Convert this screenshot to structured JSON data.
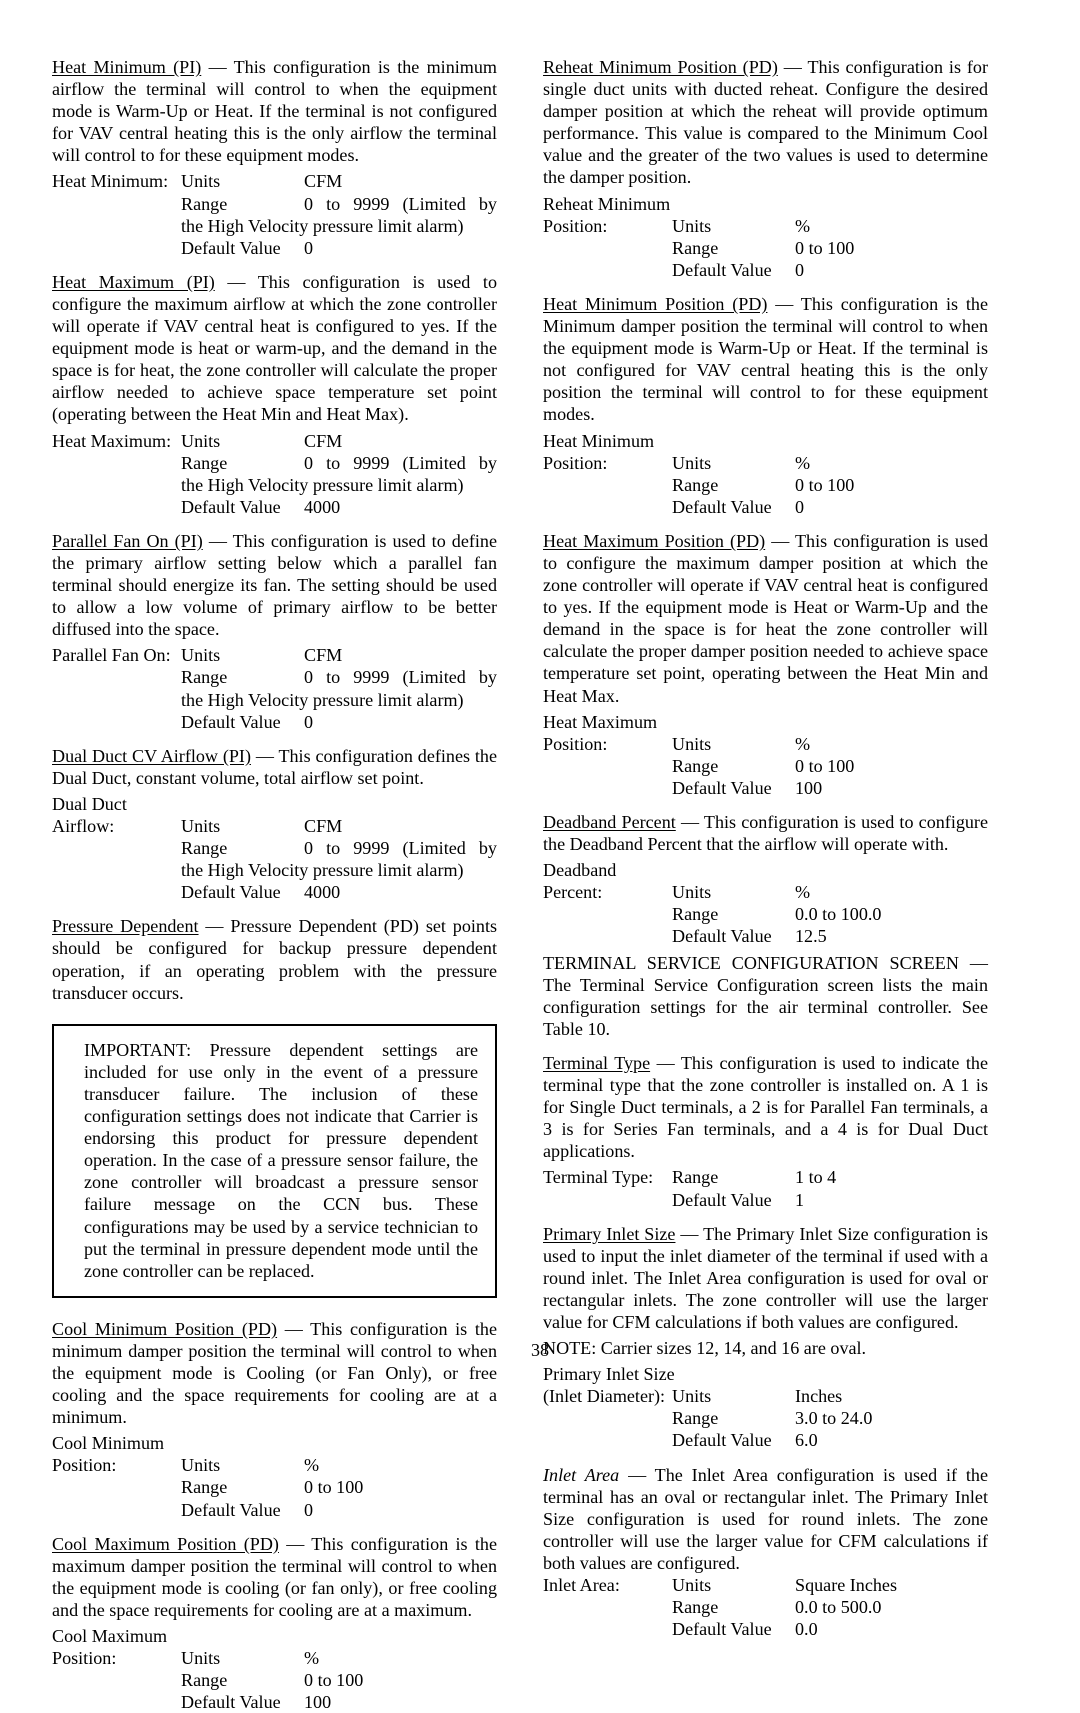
{
  "page": {
    "number": "38"
  },
  "left_column": {
    "sections": [
      {
        "id": "heat-minimum-pi",
        "heading": "Heat Minimum (PI)",
        "heading_style": "underline",
        "body": "— This configuration is the minimum airflow the terminal will control to when the equipment mode is Warm-Up or Heat. If the terminal is not configured for VAV central heating this is the only airflow the terminal will control to for these equipment modes.",
        "spec": {
          "label": "Heat Minimum:",
          "rows": [
            {
              "key": "Units",
              "value": "CFM"
            },
            {
              "key": "Range",
              "value": "0 to 9999 (Limited by",
              "continuation": "the High Velocity pressure limit alarm)"
            },
            {
              "key": "Default Value",
              "value": "0"
            }
          ]
        }
      },
      {
        "id": "heat-maximum-pi",
        "heading": "Heat Maximum (PI)",
        "heading_style": "underline",
        "body": "— This configuration is used to configure the maximum airflow at which the zone controller will operate if VAV central heat is configured to yes. If the equipment mode is heat or warm-up, and the demand in the space is for heat, the zone controller will calculate the proper airflow needed to achieve space temperature set point (operating between the Heat Min and Heat Max).",
        "spec": {
          "label": "Heat Maximum:",
          "rows": [
            {
              "key": "Units",
              "value": "CFM"
            },
            {
              "key": "Range",
              "value": "0 to 9999 (Limited by",
              "continuation": "the High Velocity pressure limit alarm)"
            },
            {
              "key": "Default Value",
              "value": "4000"
            }
          ]
        }
      },
      {
        "id": "parallel-fan-on-pi",
        "heading": "Parallel Fan On (PI)",
        "heading_style": "underline",
        "body": "— This configuration is used to define the primary airflow setting below which a parallel fan terminal should energize its fan. The setting should be used to allow a low volume of primary airflow to be better diffused into the space.",
        "spec": {
          "label": "Parallel Fan On:",
          "rows": [
            {
              "key": "Units",
              "value": "CFM"
            },
            {
              "key": "Range",
              "value": "0 to 9999 (Limited by",
              "continuation": "the High Velocity pressure limit alarm)"
            },
            {
              "key": "Default Value",
              "value": "0"
            }
          ]
        }
      },
      {
        "id": "dual-duct-cv-airflow-pi",
        "heading": "Dual Duct CV Airflow (PI)",
        "heading_style": "underline",
        "body": "— This configuration defines the Dual Duct, constant volume, total airflow set point.",
        "spec": {
          "label_line1": "Dual Duct",
          "label": "Airflow:",
          "rows": [
            {
              "key": "Units",
              "value": "CFM"
            },
            {
              "key": "Range",
              "value": "0 to 9999 (Limited by",
              "continuation": "the High Velocity pressure limit alarm)"
            },
            {
              "key": "Default Value",
              "value": "4000"
            }
          ]
        }
      },
      {
        "id": "pressure-dependent",
        "heading": "Pressure Dependent",
        "heading_style": "underline",
        "body": "— Pressure Dependent (PD) set points should be configured for backup pressure dependent operation, if an operating problem with the pressure transducer occurs."
      }
    ],
    "important_box": {
      "label": "IMPORTANT:",
      "text": "Pressure dependent settings are included for use only in the event of a pressure transducer failure. The inclusion of these configuration settings does not indicate that Carrier is endorsing this product for pressure dependent operation. In the case of a pressure sensor failure, the zone controller will broadcast a pressure sensor failure message on the CCN bus. These configurations may be used by a service technician to put the terminal in pressure dependent mode until the zone controller can be replaced."
    },
    "sections_after_box": [
      {
        "id": "cool-minimum-position-pd",
        "heading": "Cool Minimum Position (PD)",
        "heading_style": "underline",
        "body": "— This configuration is the minimum damper position the terminal will control to when the equipment mode is Cooling (or Fan Only), or free cooling and the space requirements for cooling are at a minimum.",
        "spec": {
          "label_line1": "Cool Minimum",
          "label": "Position:",
          "rows": [
            {
              "key": "Units",
              "value": "%"
            },
            {
              "key": "Range",
              "value": "0 to 100"
            },
            {
              "key": "Default Value",
              "value": "0"
            }
          ]
        }
      },
      {
        "id": "cool-maximum-position-pd",
        "heading": "Cool Maximum Position (PD)",
        "heading_style": "underline",
        "body": "— This configuration is the maximum damper position the terminal will control to when the equipment mode is cooling (or fan only), or free cooling and the space requirements for cooling are at a maximum.",
        "spec": {
          "label_line1": "Cool Maximum",
          "label": "Position:",
          "rows": [
            {
              "key": "Units",
              "value": "%"
            },
            {
              "key": "Range",
              "value": "0 to 100"
            },
            {
              "key": "Default Value",
              "value": "100"
            }
          ]
        }
      }
    ]
  },
  "right_column": {
    "sections": [
      {
        "id": "reheat-minimum-position-pd",
        "heading": "Reheat Minimum Position (PD)",
        "heading_style": "underline",
        "body": "— This configuration is for single duct units with ducted reheat. Configure the desired damper position at which the reheat will provide optimum performance. This value is compared to the Minimum Cool value and the greater of the two values is used to determine the damper position.",
        "spec": {
          "label_line1": "Reheat Minimum",
          "label": "Position:",
          "rows": [
            {
              "key": "Units",
              "value": "%"
            },
            {
              "key": "Range",
              "value": "0 to 100"
            },
            {
              "key": "Default Value",
              "value": "0"
            }
          ]
        }
      },
      {
        "id": "heat-minimum-position-pd",
        "heading": "Heat Minimum Position (PD)",
        "heading_style": "underline",
        "body": "— This configuration is the Minimum damper position the terminal will control to when the equipment mode is Warm-Up or Heat. If the terminal is not configured for VAV central heating this is the only position the terminal will control to for these equipment modes.",
        "spec": {
          "label_line1": "Heat Minimum",
          "label": "Position:",
          "rows": [
            {
              "key": "Units",
              "value": "%"
            },
            {
              "key": "Range",
              "value": "0 to 100"
            },
            {
              "key": "Default Value",
              "value": "0"
            }
          ]
        }
      },
      {
        "id": "heat-maximum-position-pd",
        "heading": "Heat Maximum Position (PD)",
        "heading_style": "underline",
        "body": "— This configuration is used to configure the maximum damper position at which the zone controller will operate if VAV central heat is configured to yes. If the equipment mode is Heat or Warm-Up and the demand in the space is for heat the zone controller will calculate the proper damper position needed to achieve space temperature set point, operating between the Heat Min and Heat Max.",
        "spec": {
          "label_line1": "Heat Maximum",
          "label": "Position:",
          "rows": [
            {
              "key": "Units",
              "value": "%"
            },
            {
              "key": "Range",
              "value": "0 to 100"
            },
            {
              "key": "Default Value",
              "value": "100"
            }
          ]
        }
      },
      {
        "id": "deadband-percent",
        "heading": "Deadband Percent",
        "heading_style": "underline",
        "body": "— This configuration is used to configure the Deadband Percent that the airflow will operate with.",
        "spec": {
          "label_line1": "Deadband",
          "label": "Percent:",
          "rows": [
            {
              "key": "Units",
              "value": "%"
            },
            {
              "key": "Range",
              "value": "0.0 to 100.0"
            },
            {
              "key": "Default Value",
              "value": "12.5"
            }
          ]
        }
      },
      {
        "id": "terminal-service-configuration-screen",
        "heading": "TERMINAL SERVICE CONFIGURATION SCREEN",
        "heading_style": "caps",
        "body": "— The Terminal Service Configuration screen lists the main configuration settings for the air terminal controller. See Table 10."
      },
      {
        "id": "terminal-type",
        "heading": "Terminal Type",
        "heading_style": "underline",
        "body": "— This configuration is used to indicate the terminal type that the zone controller is installed on. A 1 is for Single Duct terminals, a 2 is for Parallel Fan terminals, a 3 is for Series Fan terminals, and a 4 is for Dual Duct applications.",
        "spec": {
          "label": "Terminal Type:",
          "rows": [
            {
              "key": "Range",
              "value": "1 to 4"
            },
            {
              "key": "Default Value",
              "value": "1"
            }
          ]
        }
      },
      {
        "id": "primary-inlet-size",
        "heading": "Primary Inlet Size",
        "heading_style": "underline",
        "body": "— The Primary Inlet Size configuration is used to input the inlet diameter of the terminal if used with a round inlet. The Inlet Area configuration is used for oval or rectangular inlets. The zone controller will use the larger value for CFM calculations if both values are configured.",
        "note": "NOTE:  Carrier sizes 12, 14, and 16 are oval.",
        "spec": {
          "label_line1": "Primary Inlet Size",
          "label": "(Inlet Diameter):",
          "rows": [
            {
              "key": "Units",
              "value": "Inches"
            },
            {
              "key": "Range",
              "value": "3.0 to 24.0"
            },
            {
              "key": "Default Value",
              "value": "6.0"
            }
          ]
        }
      },
      {
        "id": "inlet-area",
        "heading": "Inlet Area",
        "heading_style": "italic",
        "body": "— The Inlet Area configuration is used if the terminal has an oval or rectangular inlet. The Primary Inlet Size configuration is used for round inlets. The zone controller will use the larger value for CFM calculations if both values are configured.",
        "spec": {
          "label": "Inlet Area:",
          "rows": [
            {
              "key": "Units",
              "value": "Square Inches"
            },
            {
              "key": "Range",
              "value": "0.0 to 500.0"
            },
            {
              "key": "Default Value",
              "value": "0.0"
            }
          ]
        }
      }
    ]
  }
}
